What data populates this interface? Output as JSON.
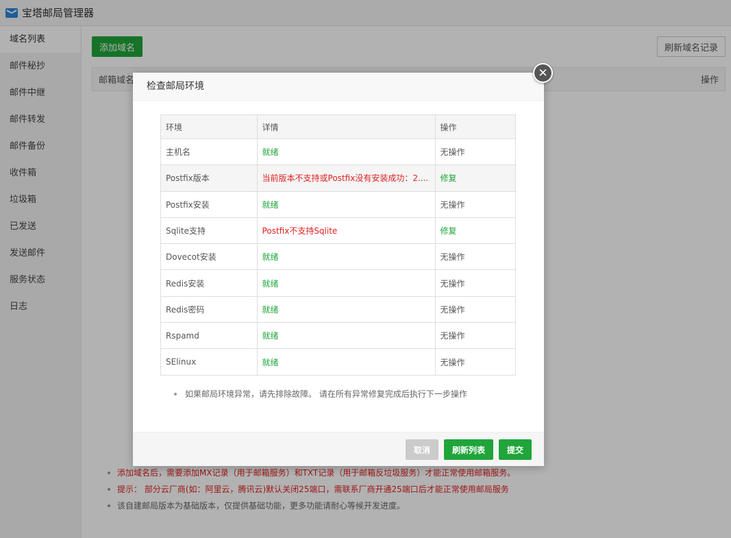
{
  "app": {
    "title": "宝塔邮局管理器"
  },
  "sidebar": {
    "items": [
      {
        "label": "域名列表"
      },
      {
        "label": "邮件秘抄"
      },
      {
        "label": "邮件中继"
      },
      {
        "label": "邮件转发"
      },
      {
        "label": "邮件备份"
      },
      {
        "label": "收件箱"
      },
      {
        "label": "垃圾箱"
      },
      {
        "label": "已发送"
      },
      {
        "label": "发送邮件"
      },
      {
        "label": "服务状态"
      },
      {
        "label": "日志"
      }
    ]
  },
  "main": {
    "add_domain_label": "添加域名",
    "refresh_records_label": "刷新域名记录",
    "col_domain": "邮箱域名",
    "col_action": "操作",
    "tips": [
      "添加域名后，需要添加MX记录（用于邮箱服务）和TXT记录（用于邮箱反垃圾服务）才能正常使用邮箱服务。",
      "提示： 部分云厂商(如：阿里云，腾讯云)默认关闭25端口，需联系厂商开通25端口后才能正常使用邮局服务",
      "该自建邮局版本为基础版本，仅提供基础功能，更多功能请耐心等候开发进度。"
    ]
  },
  "modal": {
    "title": "检查邮局环境",
    "close_glyph": "✕",
    "headers": {
      "env": "环境",
      "detail": "详情",
      "op": "操作"
    },
    "rows": [
      {
        "env": "主机名",
        "detail": "就绪",
        "op": "无操作"
      },
      {
        "env": "Postfix版本",
        "detail": "当前版本不支持或Postfix没有安装成功：2....",
        "op": "修复"
      },
      {
        "env": "Postfix安装",
        "detail": "就绪",
        "op": "无操作"
      },
      {
        "env": "Sqlite支持",
        "detail": "Postfix不支持Sqlite",
        "op": "修复"
      },
      {
        "env": "Dovecot安装",
        "detail": "就绪",
        "op": "无操作"
      },
      {
        "env": "Redis安装",
        "detail": "就绪",
        "op": "无操作"
      },
      {
        "env": "Redis密码",
        "detail": "就绪",
        "op": "无操作"
      },
      {
        "env": "Rspamd",
        "detail": "就绪",
        "op": "无操作"
      },
      {
        "env": "SElinux",
        "detail": "就绪",
        "op": "无操作"
      }
    ],
    "tip": "如果邮局环境异常，请先排除故障。 请在所有异常修复完成后执行下一步操作",
    "cancel_label": "取消",
    "refresh_label": "刷新列表",
    "submit_label": "提交"
  },
  "colors": {
    "accent_green": "#20a53a",
    "error_red": "#e02020",
    "disabled_gray": "#cbcbcb"
  }
}
